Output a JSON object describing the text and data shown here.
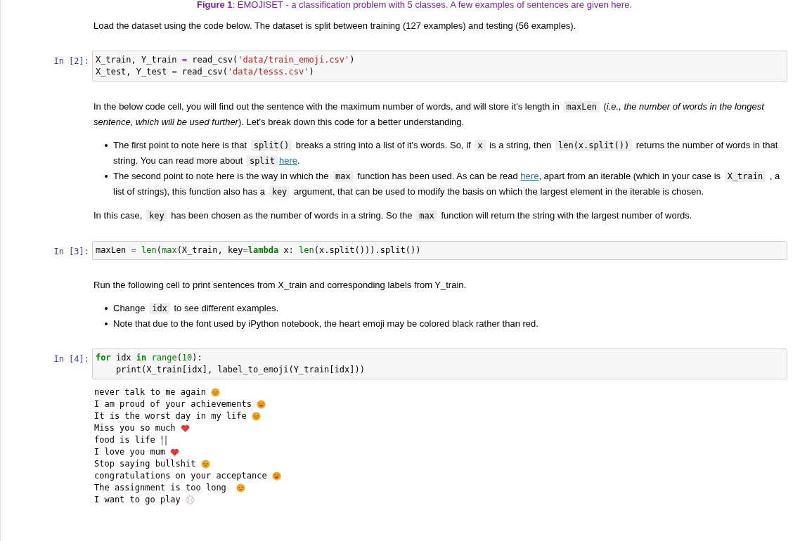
{
  "caption": [
    {
      "kind": "bold",
      "text": "Figure 1"
    },
    {
      "kind": "text",
      "text": ": EMOJISET - a classification problem with 5 classes. A few examples of sentences are given here."
    }
  ],
  "cells": [
    {
      "kind": "markdown",
      "blocks": [
        {
          "kind": "p",
          "segments": [
            {
              "kind": "text",
              "text": "Load the dataset using the code below. The dataset is split between training (127 examples) and testing (56 examples)."
            }
          ]
        }
      ]
    },
    {
      "kind": "code",
      "prompt": "In [2]:",
      "lines": [
        [
          {
            "kind": "plain",
            "text": "X_train, Y_train "
          },
          {
            "kind": "op",
            "text": "="
          },
          {
            "kind": "plain",
            "text": " read_csv("
          },
          {
            "kind": "str",
            "text": "'data/train_emoji.csv'"
          },
          {
            "kind": "plain",
            "text": ")"
          }
        ],
        [
          {
            "kind": "plain",
            "text": "X_test, Y_test "
          },
          {
            "kind": "op",
            "text": "="
          },
          {
            "kind": "plain",
            "text": " read_csv("
          },
          {
            "kind": "str",
            "text": "'data/tesss.csv'"
          },
          {
            "kind": "plain",
            "text": ")"
          }
        ]
      ]
    },
    {
      "kind": "markdown",
      "blocks": [
        {
          "kind": "p",
          "segments": [
            {
              "kind": "text",
              "text": "In the below code cell, you will find out the sentence with the maximum number of words, and will store it's length in "
            },
            {
              "kind": "code",
              "text": "maxLen"
            },
            {
              "kind": "text",
              "text": " ("
            },
            {
              "kind": "italic",
              "text": "i.e., the number of words in the longest sentence, which will be used further"
            },
            {
              "kind": "text",
              "text": "). Let's break down this code for a better understanding."
            }
          ]
        },
        {
          "kind": "ul",
          "items": [
            [
              {
                "kind": "text",
                "text": "The first point to note here is that "
              },
              {
                "kind": "code",
                "text": "split()"
              },
              {
                "kind": "text",
                "text": " breaks a string into a list of it's words. So, if "
              },
              {
                "kind": "code",
                "text": "x"
              },
              {
                "kind": "text",
                "text": " is a string, then "
              },
              {
                "kind": "code",
                "text": "len(x.split())"
              },
              {
                "kind": "text",
                "text": " returns the number of words in that string. You can read more about "
              },
              {
                "kind": "code",
                "text": "split"
              },
              {
                "kind": "link",
                "text": "here"
              },
              {
                "kind": "text",
                "text": "."
              }
            ],
            [
              {
                "kind": "text",
                "text": "The second point to note here is the way in which the "
              },
              {
                "kind": "code",
                "text": "max"
              },
              {
                "kind": "text",
                "text": " function has been used. As can be read "
              },
              {
                "kind": "link",
                "text": "here"
              },
              {
                "kind": "text",
                "text": ", apart from an iterable (which in your case is "
              },
              {
                "kind": "code",
                "text": "X_train"
              },
              {
                "kind": "text",
                "text": " , a list of strings), this function also has a "
              },
              {
                "kind": "code",
                "text": "key"
              },
              {
                "kind": "text",
                "text": " argument, that can be used to modify the basis on which the largest element in the iterable is chosen."
              }
            ]
          ]
        },
        {
          "kind": "p",
          "segments": [
            {
              "kind": "text",
              "text": "In this case, "
            },
            {
              "kind": "code",
              "text": "key"
            },
            {
              "kind": "text",
              "text": " has been chosen as the number of words in a string. So the "
            },
            {
              "kind": "code",
              "text": "max"
            },
            {
              "kind": "text",
              "text": " function will return the string with the largest number of words."
            }
          ]
        }
      ]
    },
    {
      "kind": "code",
      "prompt": "In [3]:",
      "lines": [
        [
          {
            "kind": "plain",
            "text": "maxLen "
          },
          {
            "kind": "op",
            "text": "= "
          },
          {
            "kind": "builtin",
            "text": "len"
          },
          {
            "kind": "plain",
            "text": "("
          },
          {
            "kind": "builtin",
            "text": "max"
          },
          {
            "kind": "plain",
            "text": "(X_train, key"
          },
          {
            "kind": "op",
            "text": "="
          },
          {
            "kind": "kw",
            "text": "lambda"
          },
          {
            "kind": "plain",
            "text": " x: "
          },
          {
            "kind": "builtin",
            "text": "len"
          },
          {
            "kind": "plain",
            "text": "(x.split())).split())"
          }
        ]
      ]
    },
    {
      "kind": "markdown",
      "blocks": [
        {
          "kind": "p",
          "segments": [
            {
              "kind": "text",
              "text": "Run the following cell to print sentences from X_train and corresponding labels from Y_train."
            }
          ]
        },
        {
          "kind": "ul",
          "items": [
            [
              {
                "kind": "text",
                "text": "Change "
              },
              {
                "kind": "code",
                "text": "idx"
              },
              {
                "kind": "text",
                "text": " to see different examples."
              }
            ],
            [
              {
                "kind": "text",
                "text": "Note that due to the font used by iPython notebook, the heart emoji may be colored black rather than red."
              }
            ]
          ]
        }
      ]
    },
    {
      "kind": "code",
      "prompt": "In [4]:",
      "lines": [
        [
          {
            "kind": "kw",
            "text": "for"
          },
          {
            "kind": "plain",
            "text": " idx "
          },
          {
            "kind": "kw",
            "text": "in "
          },
          {
            "kind": "builtin",
            "text": "range"
          },
          {
            "kind": "plain",
            "text": "("
          },
          {
            "kind": "num",
            "text": "10"
          },
          {
            "kind": "plain",
            "text": "):"
          }
        ],
        [
          {
            "kind": "plain",
            "text": "    print(X_train[idx], label_to_emoji(Y_train[idx]))"
          }
        ]
      ],
      "output": [
        {
          "text": "never talk to me again ",
          "kind": "disappointed"
        },
        {
          "text": "I am proud of your achievements ",
          "kind": "smile"
        },
        {
          "text": "It is the worst day in my life ",
          "kind": "disappointed"
        },
        {
          "text": "Miss you so much ",
          "kind": "heart"
        },
        {
          "text": "food is life ",
          "kind": "fork"
        },
        {
          "text": "I love you mum ",
          "kind": "heart"
        },
        {
          "text": "Stop saying bullshit ",
          "kind": "disappointed"
        },
        {
          "text": "congratulations on your acceptance ",
          "kind": "smile"
        },
        {
          "text": "The assignment is too long  ",
          "kind": "disappointed"
        },
        {
          "text": "I want to go play ",
          "kind": "ball"
        }
      ]
    }
  ]
}
